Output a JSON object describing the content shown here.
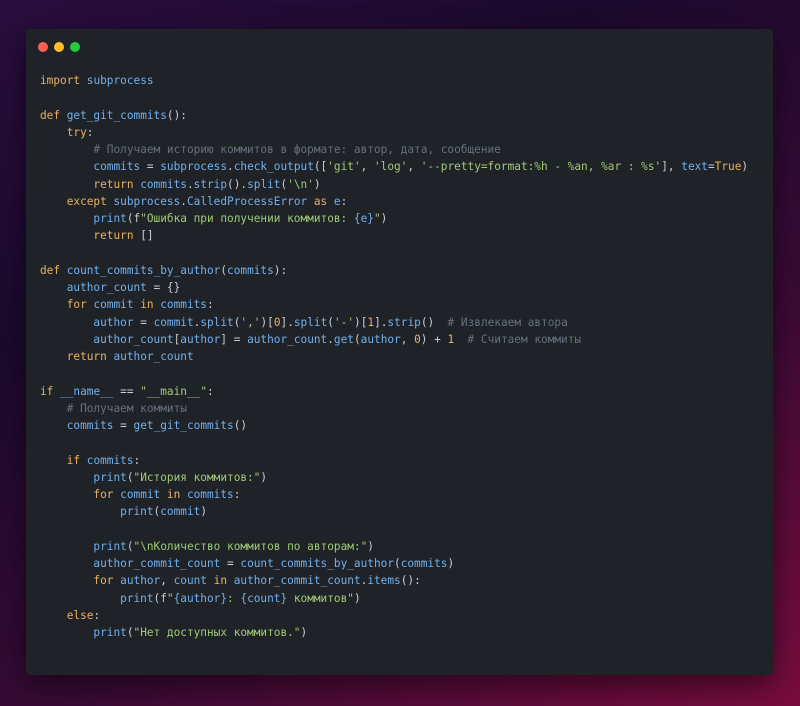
{
  "window": {
    "controls": [
      {
        "name": "close",
        "color": "#ff5f56"
      },
      {
        "name": "minimize",
        "color": "#ffbd2e"
      },
      {
        "name": "maximize",
        "color": "#27c93f"
      }
    ]
  },
  "code_lines": [
    [
      {
        "t": "import ",
        "c": "kw"
      },
      {
        "t": "subprocess",
        "c": "id"
      }
    ],
    [],
    [
      {
        "t": "def ",
        "c": "kw"
      },
      {
        "t": "get_git_commits",
        "c": "fn"
      },
      {
        "t": "():",
        "c": "p"
      }
    ],
    [
      {
        "t": "    try",
        "c": "kw"
      },
      {
        "t": ":",
        "c": "p"
      }
    ],
    [
      {
        "t": "        # Получаем историю коммитов в формате: автор, дата, сообщение",
        "c": "cm"
      }
    ],
    [
      {
        "t": "        commits",
        "c": "id"
      },
      {
        "t": " = ",
        "c": "p"
      },
      {
        "t": "subprocess",
        "c": "id"
      },
      {
        "t": ".",
        "c": "p"
      },
      {
        "t": "check_output",
        "c": "fn"
      },
      {
        "t": "([",
        "c": "p"
      },
      {
        "t": "'git'",
        "c": "str"
      },
      {
        "t": ", ",
        "c": "p"
      },
      {
        "t": "'log'",
        "c": "str"
      },
      {
        "t": ", ",
        "c": "p"
      },
      {
        "t": "'--pretty=format:%h - %an, %ar : %s'",
        "c": "str"
      },
      {
        "t": "], ",
        "c": "p"
      },
      {
        "t": "text",
        "c": "id"
      },
      {
        "t": "=",
        "c": "p"
      },
      {
        "t": "True",
        "c": "kw"
      },
      {
        "t": ")",
        "c": "p"
      }
    ],
    [
      {
        "t": "        return ",
        "c": "kw"
      },
      {
        "t": "commits",
        "c": "id"
      },
      {
        "t": ".",
        "c": "p"
      },
      {
        "t": "strip",
        "c": "fn"
      },
      {
        "t": "().",
        "c": "p"
      },
      {
        "t": "split",
        "c": "fn"
      },
      {
        "t": "(",
        "c": "p"
      },
      {
        "t": "'\\n'",
        "c": "str"
      },
      {
        "t": ")",
        "c": "p"
      }
    ],
    [
      {
        "t": "    except ",
        "c": "kw"
      },
      {
        "t": "subprocess",
        "c": "id"
      },
      {
        "t": ".",
        "c": "p"
      },
      {
        "t": "CalledProcessError",
        "c": "fn"
      },
      {
        "t": " as ",
        "c": "kw"
      },
      {
        "t": "e",
        "c": "id"
      },
      {
        "t": ":",
        "c": "p"
      }
    ],
    [
      {
        "t": "        print",
        "c": "fn"
      },
      {
        "t": "(f",
        "c": "p"
      },
      {
        "t": "\"Ошибка при получении коммитов: ",
        "c": "str"
      },
      {
        "t": "{e}",
        "c": "id"
      },
      {
        "t": "\"",
        "c": "str"
      },
      {
        "t": ")",
        "c": "p"
      }
    ],
    [
      {
        "t": "        return ",
        "c": "kw"
      },
      {
        "t": "[]",
        "c": "p"
      }
    ],
    [],
    [
      {
        "t": "def ",
        "c": "kw"
      },
      {
        "t": "count_commits_by_author",
        "c": "fn"
      },
      {
        "t": "(",
        "c": "p"
      },
      {
        "t": "commits",
        "c": "id"
      },
      {
        "t": "):",
        "c": "p"
      }
    ],
    [
      {
        "t": "    author_count",
        "c": "id"
      },
      {
        "t": " = {}",
        "c": "p"
      }
    ],
    [
      {
        "t": "    for ",
        "c": "kw"
      },
      {
        "t": "commit",
        "c": "id"
      },
      {
        "t": " in ",
        "c": "kw"
      },
      {
        "t": "commits",
        "c": "id"
      },
      {
        "t": ":",
        "c": "p"
      }
    ],
    [
      {
        "t": "        author",
        "c": "id"
      },
      {
        "t": " = ",
        "c": "p"
      },
      {
        "t": "commit",
        "c": "id"
      },
      {
        "t": ".",
        "c": "p"
      },
      {
        "t": "split",
        "c": "fn"
      },
      {
        "t": "(",
        "c": "p"
      },
      {
        "t": "','",
        "c": "str"
      },
      {
        "t": ")[",
        "c": "p"
      },
      {
        "t": "0",
        "c": "num"
      },
      {
        "t": "].",
        "c": "p"
      },
      {
        "t": "split",
        "c": "fn"
      },
      {
        "t": "(",
        "c": "p"
      },
      {
        "t": "'-'",
        "c": "str"
      },
      {
        "t": ")[",
        "c": "p"
      },
      {
        "t": "1",
        "c": "num"
      },
      {
        "t": "].",
        "c": "p"
      },
      {
        "t": "strip",
        "c": "fn"
      },
      {
        "t": "()  ",
        "c": "p"
      },
      {
        "t": "# Извлекаем автора",
        "c": "cm"
      }
    ],
    [
      {
        "t": "        author_count",
        "c": "id"
      },
      {
        "t": "[",
        "c": "p"
      },
      {
        "t": "author",
        "c": "id"
      },
      {
        "t": "] = ",
        "c": "p"
      },
      {
        "t": "author_count",
        "c": "id"
      },
      {
        "t": ".",
        "c": "p"
      },
      {
        "t": "get",
        "c": "fn"
      },
      {
        "t": "(",
        "c": "p"
      },
      {
        "t": "author",
        "c": "id"
      },
      {
        "t": ", ",
        "c": "p"
      },
      {
        "t": "0",
        "c": "num"
      },
      {
        "t": ") + ",
        "c": "p"
      },
      {
        "t": "1",
        "c": "num"
      },
      {
        "t": "  ",
        "c": "p"
      },
      {
        "t": "# Считаем коммиты",
        "c": "cm"
      }
    ],
    [
      {
        "t": "    return ",
        "c": "kw"
      },
      {
        "t": "author_count",
        "c": "id"
      }
    ],
    [],
    [
      {
        "t": "if ",
        "c": "kw"
      },
      {
        "t": "__name__",
        "c": "id"
      },
      {
        "t": " == ",
        "c": "p"
      },
      {
        "t": "\"__main__\"",
        "c": "str"
      },
      {
        "t": ":",
        "c": "p"
      }
    ],
    [
      {
        "t": "    # Получаем коммиты",
        "c": "cm"
      }
    ],
    [
      {
        "t": "    commits",
        "c": "id"
      },
      {
        "t": " = ",
        "c": "p"
      },
      {
        "t": "get_git_commits",
        "c": "fn"
      },
      {
        "t": "()",
        "c": "p"
      }
    ],
    [],
    [
      {
        "t": "    if ",
        "c": "kw"
      },
      {
        "t": "commits",
        "c": "id"
      },
      {
        "t": ":",
        "c": "p"
      }
    ],
    [
      {
        "t": "        print",
        "c": "fn"
      },
      {
        "t": "(",
        "c": "p"
      },
      {
        "t": "\"История коммитов:\"",
        "c": "str"
      },
      {
        "t": ")",
        "c": "p"
      }
    ],
    [
      {
        "t": "        for ",
        "c": "kw"
      },
      {
        "t": "commit",
        "c": "id"
      },
      {
        "t": " in ",
        "c": "kw"
      },
      {
        "t": "commits",
        "c": "id"
      },
      {
        "t": ":",
        "c": "p"
      }
    ],
    [
      {
        "t": "            print",
        "c": "fn"
      },
      {
        "t": "(",
        "c": "p"
      },
      {
        "t": "commit",
        "c": "id"
      },
      {
        "t": ")",
        "c": "p"
      }
    ],
    [],
    [
      {
        "t": "        print",
        "c": "fn"
      },
      {
        "t": "(",
        "c": "p"
      },
      {
        "t": "\"\\nКоличество коммитов по авторам:\"",
        "c": "str"
      },
      {
        "t": ")",
        "c": "p"
      }
    ],
    [
      {
        "t": "        author_commit_count",
        "c": "id"
      },
      {
        "t": " = ",
        "c": "p"
      },
      {
        "t": "count_commits_by_author",
        "c": "fn"
      },
      {
        "t": "(",
        "c": "p"
      },
      {
        "t": "commits",
        "c": "id"
      },
      {
        "t": ")",
        "c": "p"
      }
    ],
    [
      {
        "t": "        for ",
        "c": "kw"
      },
      {
        "t": "author",
        "c": "id"
      },
      {
        "t": ", ",
        "c": "p"
      },
      {
        "t": "count",
        "c": "id"
      },
      {
        "t": " in ",
        "c": "kw"
      },
      {
        "t": "author_commit_count",
        "c": "id"
      },
      {
        "t": ".",
        "c": "p"
      },
      {
        "t": "items",
        "c": "fn"
      },
      {
        "t": "():",
        "c": "p"
      }
    ],
    [
      {
        "t": "            print",
        "c": "fn"
      },
      {
        "t": "(f",
        "c": "p"
      },
      {
        "t": "\"",
        "c": "str"
      },
      {
        "t": "{author}",
        "c": "id"
      },
      {
        "t": ": ",
        "c": "str"
      },
      {
        "t": "{count}",
        "c": "id"
      },
      {
        "t": " коммитов\"",
        "c": "str"
      },
      {
        "t": ")",
        "c": "p"
      }
    ],
    [
      {
        "t": "    else",
        "c": "kw"
      },
      {
        "t": ":",
        "c": "p"
      }
    ],
    [
      {
        "t": "        print",
        "c": "fn"
      },
      {
        "t": "(",
        "c": "p"
      },
      {
        "t": "\"Нет доступных коммитов.\"",
        "c": "str"
      },
      {
        "t": ")",
        "c": "p"
      }
    ]
  ]
}
